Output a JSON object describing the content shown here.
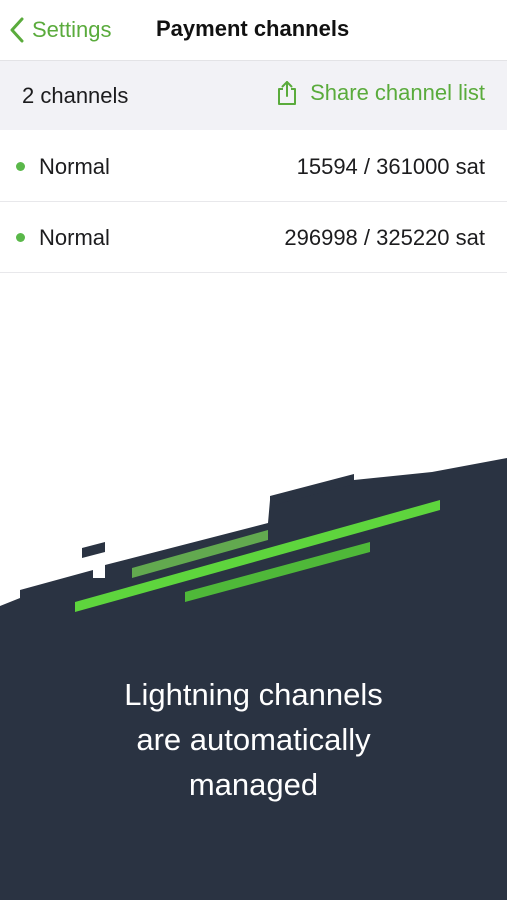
{
  "nav": {
    "back_label": "Settings",
    "title": "Payment channels"
  },
  "summary": {
    "count_label": "2 channels",
    "share_label": "Share channel list"
  },
  "channels": [
    {
      "status": "Normal",
      "balance": "15594 / 361000 sat"
    },
    {
      "status": "Normal",
      "balance": "296998 / 325220 sat"
    }
  ],
  "promo": {
    "lines": [
      "Lightning channels",
      "are automatically",
      "managed"
    ]
  },
  "colors": {
    "accent": "#5aab3c",
    "status_normal": "#5ab84a",
    "dark_panel": "#2a3342",
    "stripe_bright": "#5ed53d",
    "stripe_dim": "#62a94f"
  },
  "icons": {
    "back": "chevron-left-icon",
    "share": "share-icon",
    "status": "status-dot"
  }
}
